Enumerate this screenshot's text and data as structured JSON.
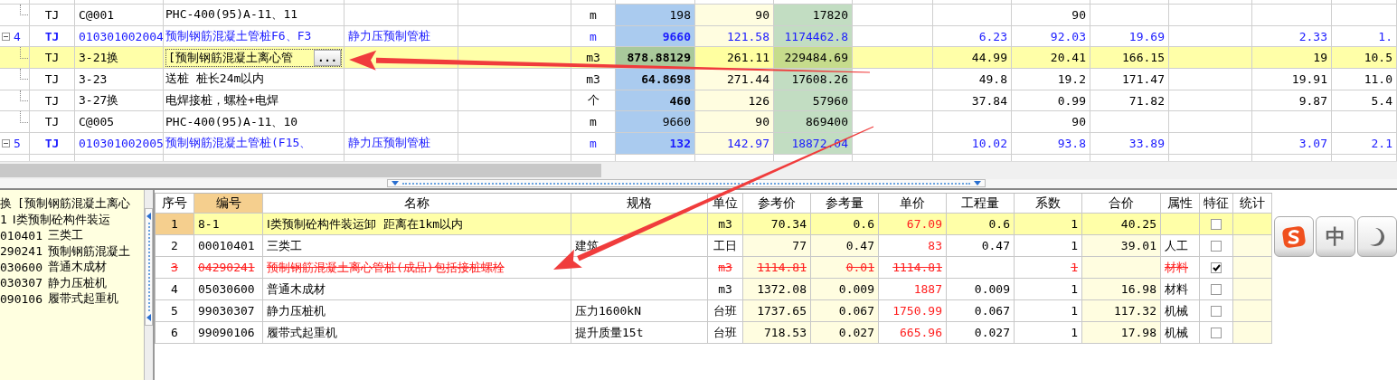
{
  "top_grid": {
    "rows": [
      {
        "kind": "sub",
        "selected": false,
        "type": "TJ",
        "code": "C@001",
        "name": "PHC-400(95)A-11、11",
        "unit": "m",
        "quantity": "198",
        "qty_bold": false,
        "unit_price": "90",
        "total": "17820",
        "column_12": "90"
      },
      {
        "kind": "item",
        "selected": false,
        "number": "4",
        "type": "TJ",
        "code": "010301002004",
        "name": "预制钢筋混凝土管桩F6、F3",
        "feature": "静力压预制管桩",
        "unit": "m",
        "quantity": "9660",
        "qty_bold": true,
        "unit_price": "121.58",
        "total": "1174462.8",
        "column_11": "6.23",
        "column_12": "92.03",
        "column_13": "19.69",
        "column_15": "2.33",
        "column_16": "1."
      },
      {
        "kind": "sub",
        "selected": true,
        "type": "TJ",
        "code": "3-21换",
        "name": "[预制钢筋混凝土离心管",
        "editor_button": "...",
        "unit": "m3",
        "quantity": "878.88129",
        "qty_bold": true,
        "unit_price": "261.11",
        "total": "229484.69",
        "column_11": "44.99",
        "column_12": "20.41",
        "column_13": "166.15",
        "column_15": "19",
        "column_16": "10.5"
      },
      {
        "kind": "sub",
        "selected": false,
        "type": "TJ",
        "code": "3-23",
        "name": "送桩 桩长24m以内",
        "unit": "m3",
        "quantity": "64.8698",
        "qty_bold": true,
        "unit_price": "271.44",
        "total": "17608.26",
        "column_11": "49.8",
        "column_12": "19.2",
        "column_13": "171.47",
        "column_15": "19.91",
        "column_16": "11.0"
      },
      {
        "kind": "sub",
        "selected": false,
        "type": "TJ",
        "code": "3-27换",
        "name": "电焊接桩，螺栓+电焊",
        "unit": "个",
        "quantity": "460",
        "qty_bold": true,
        "unit_price": "126",
        "total": "57960",
        "column_11": "37.84",
        "column_12": "0.99",
        "column_13": "71.82",
        "column_15": "9.87",
        "column_16": "5.4"
      },
      {
        "kind": "sub",
        "selected": false,
        "type": "TJ",
        "code": "C@005",
        "name": "PHC-400(95)A-11、10",
        "unit": "m",
        "quantity": "9660",
        "qty_bold": false,
        "unit_price": "90",
        "total": "869400",
        "column_12": "90"
      },
      {
        "kind": "item",
        "selected": false,
        "number": "5",
        "type": "TJ",
        "code": "010301002005",
        "name": "预制钢筋混凝土管桩(F15、",
        "feature": "静力压预制管桩",
        "unit": "m",
        "quantity": "132",
        "qty_bold": true,
        "unit_price": "142.97",
        "total": "18872.04",
        "column_11": "10.02",
        "column_12": "93.8",
        "column_13": "33.89",
        "column_15": "3.07",
        "column_16": "2.1"
      }
    ]
  },
  "left_panel": {
    "items": [
      {
        "code": "换",
        "name": "[预制钢筋混凝土离心"
      },
      {
        "code": "1",
        "name": "Ⅰ类预制砼构件装运"
      },
      {
        "code": "010401",
        "name": "三类工"
      },
      {
        "code": "290241",
        "name": "预制钢筋混凝土"
      },
      {
        "code": "030600",
        "name": "普通木成材"
      },
      {
        "code": "030307",
        "name": "静力压桩机"
      },
      {
        "code": "090106",
        "name": "履带式起重机"
      }
    ]
  },
  "resource_table": {
    "columns": [
      {
        "label": "序号",
        "selected": false
      },
      {
        "label": "编号",
        "selected": true
      },
      {
        "label": "名称",
        "selected": false
      },
      {
        "label": "规格",
        "selected": false
      },
      {
        "label": "单位",
        "selected": false
      },
      {
        "label": "参考价",
        "selected": false
      },
      {
        "label": "参考量",
        "selected": false
      },
      {
        "label": "单价",
        "selected": false
      },
      {
        "label": "工程量",
        "selected": false
      },
      {
        "label": "系数",
        "selected": false
      },
      {
        "label": "合价",
        "selected": false
      },
      {
        "label": "属性",
        "selected": false
      },
      {
        "label": "特征",
        "selected": false
      },
      {
        "label": "统计",
        "selected": false
      }
    ],
    "rows": [
      {
        "selected": true,
        "struck": false,
        "feature_checked": false,
        "seq": "1",
        "code": "8-1",
        "name": "Ⅰ类预制砼构件装运卸 距离在1km以内",
        "unit": "m3",
        "ref_price": "70.34",
        "ref_qty": "0.6",
        "price": "67.09",
        "qty": "0.6",
        "coef": "1",
        "total": "40.25"
      },
      {
        "selected": false,
        "struck": false,
        "feature_checked": false,
        "seq": "2",
        "code": "00010401",
        "name": "三类工",
        "spec": "建筑",
        "unit": "工日",
        "ref_price": "77",
        "ref_qty": "0.47",
        "price": "83",
        "qty": "0.47",
        "coef": "1",
        "total": "39.01",
        "attr": "人工"
      },
      {
        "selected": false,
        "struck": true,
        "feature_checked": true,
        "seq": "3",
        "code": "04290241",
        "name": "预制钢筋混凝土离心管桩(成品)包括接桩螺栓",
        "unit": "m3",
        "ref_price": "1114.81",
        "ref_qty": "0.01",
        "price": "1114.81",
        "coef": "1",
        "attr": "材料"
      },
      {
        "selected": false,
        "struck": false,
        "feature_checked": false,
        "seq": "4",
        "code": "05030600",
        "name": "普通木成材",
        "unit": "m3",
        "ref_price": "1372.08",
        "ref_qty": "0.009",
        "price": "1887",
        "qty": "0.009",
        "coef": "1",
        "total": "16.98",
        "attr": "材料"
      },
      {
        "selected": false,
        "struck": false,
        "feature_checked": false,
        "seq": "5",
        "code": "99030307",
        "name": "静力压桩机",
        "spec": "压力1600kN",
        "unit": "台班",
        "ref_price": "1737.65",
        "ref_qty": "0.067",
        "price": "1750.99",
        "qty": "0.067",
        "coef": "1",
        "total": "117.32",
        "attr": "机械"
      },
      {
        "selected": false,
        "struck": false,
        "feature_checked": false,
        "seq": "6",
        "code": "99090106",
        "name": "履带式起重机",
        "spec": "提升质量15t",
        "unit": "台班",
        "ref_price": "718.53",
        "ref_qty": "0.027",
        "price": "665.96",
        "qty": "0.027",
        "coef": "1",
        "total": "17.98",
        "attr": "机械"
      }
    ]
  },
  "ime_bar": {
    "keys": [
      {
        "kind": "logo"
      },
      {
        "kind": "text",
        "label": "中"
      },
      {
        "kind": "moon"
      }
    ]
  }
}
